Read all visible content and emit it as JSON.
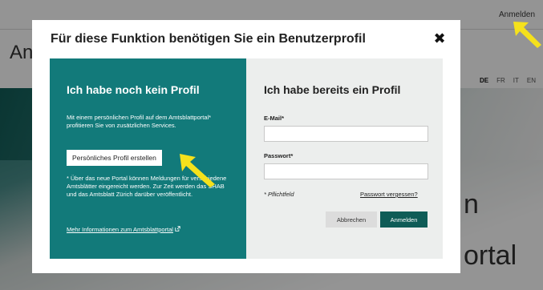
{
  "background": {
    "login_link": "Anmelden",
    "title_fragment": "An",
    "languages": [
      "DE",
      "FR",
      "IT",
      "EN"
    ],
    "active_language": "DE",
    "hero_text_1": "n",
    "hero_text_2": "ortal"
  },
  "modal": {
    "title": "Für diese Funktion benötigen Sie ein Benutzerprofil",
    "close_symbol": "✖",
    "left": {
      "heading": "Ich habe noch kein Profil",
      "intro": "Mit einem persönlichen Profil auf dem Amtsblattportal* profitieren Sie von zusätzlichen Services.",
      "create_button": "Persönliches Profil erstellen",
      "note": "* Über das neue Portal können Meldungen für verschiedene Amtsblätter eingereicht werden. Zur Zeit werden das SHAB und das Amtsblatt Zürich darüber veröffentlicht.",
      "info_link": "Mehr Informationen zum Amtsblattportal"
    },
    "right": {
      "heading": "Ich habe bereits ein Profil",
      "email_label": "E-Mail*",
      "email_value": "",
      "password_label": "Passwort*",
      "password_value": "",
      "required_note": "* Pflichtfeld",
      "forgot_link": "Passwort vergessen?",
      "cancel_button": "Abbrechen",
      "login_button": "Anmelden"
    }
  },
  "colors": {
    "teal_panel": "#127a7a",
    "dark_teal_button": "#0f5c57",
    "arrow_yellow": "#f5e11c"
  }
}
